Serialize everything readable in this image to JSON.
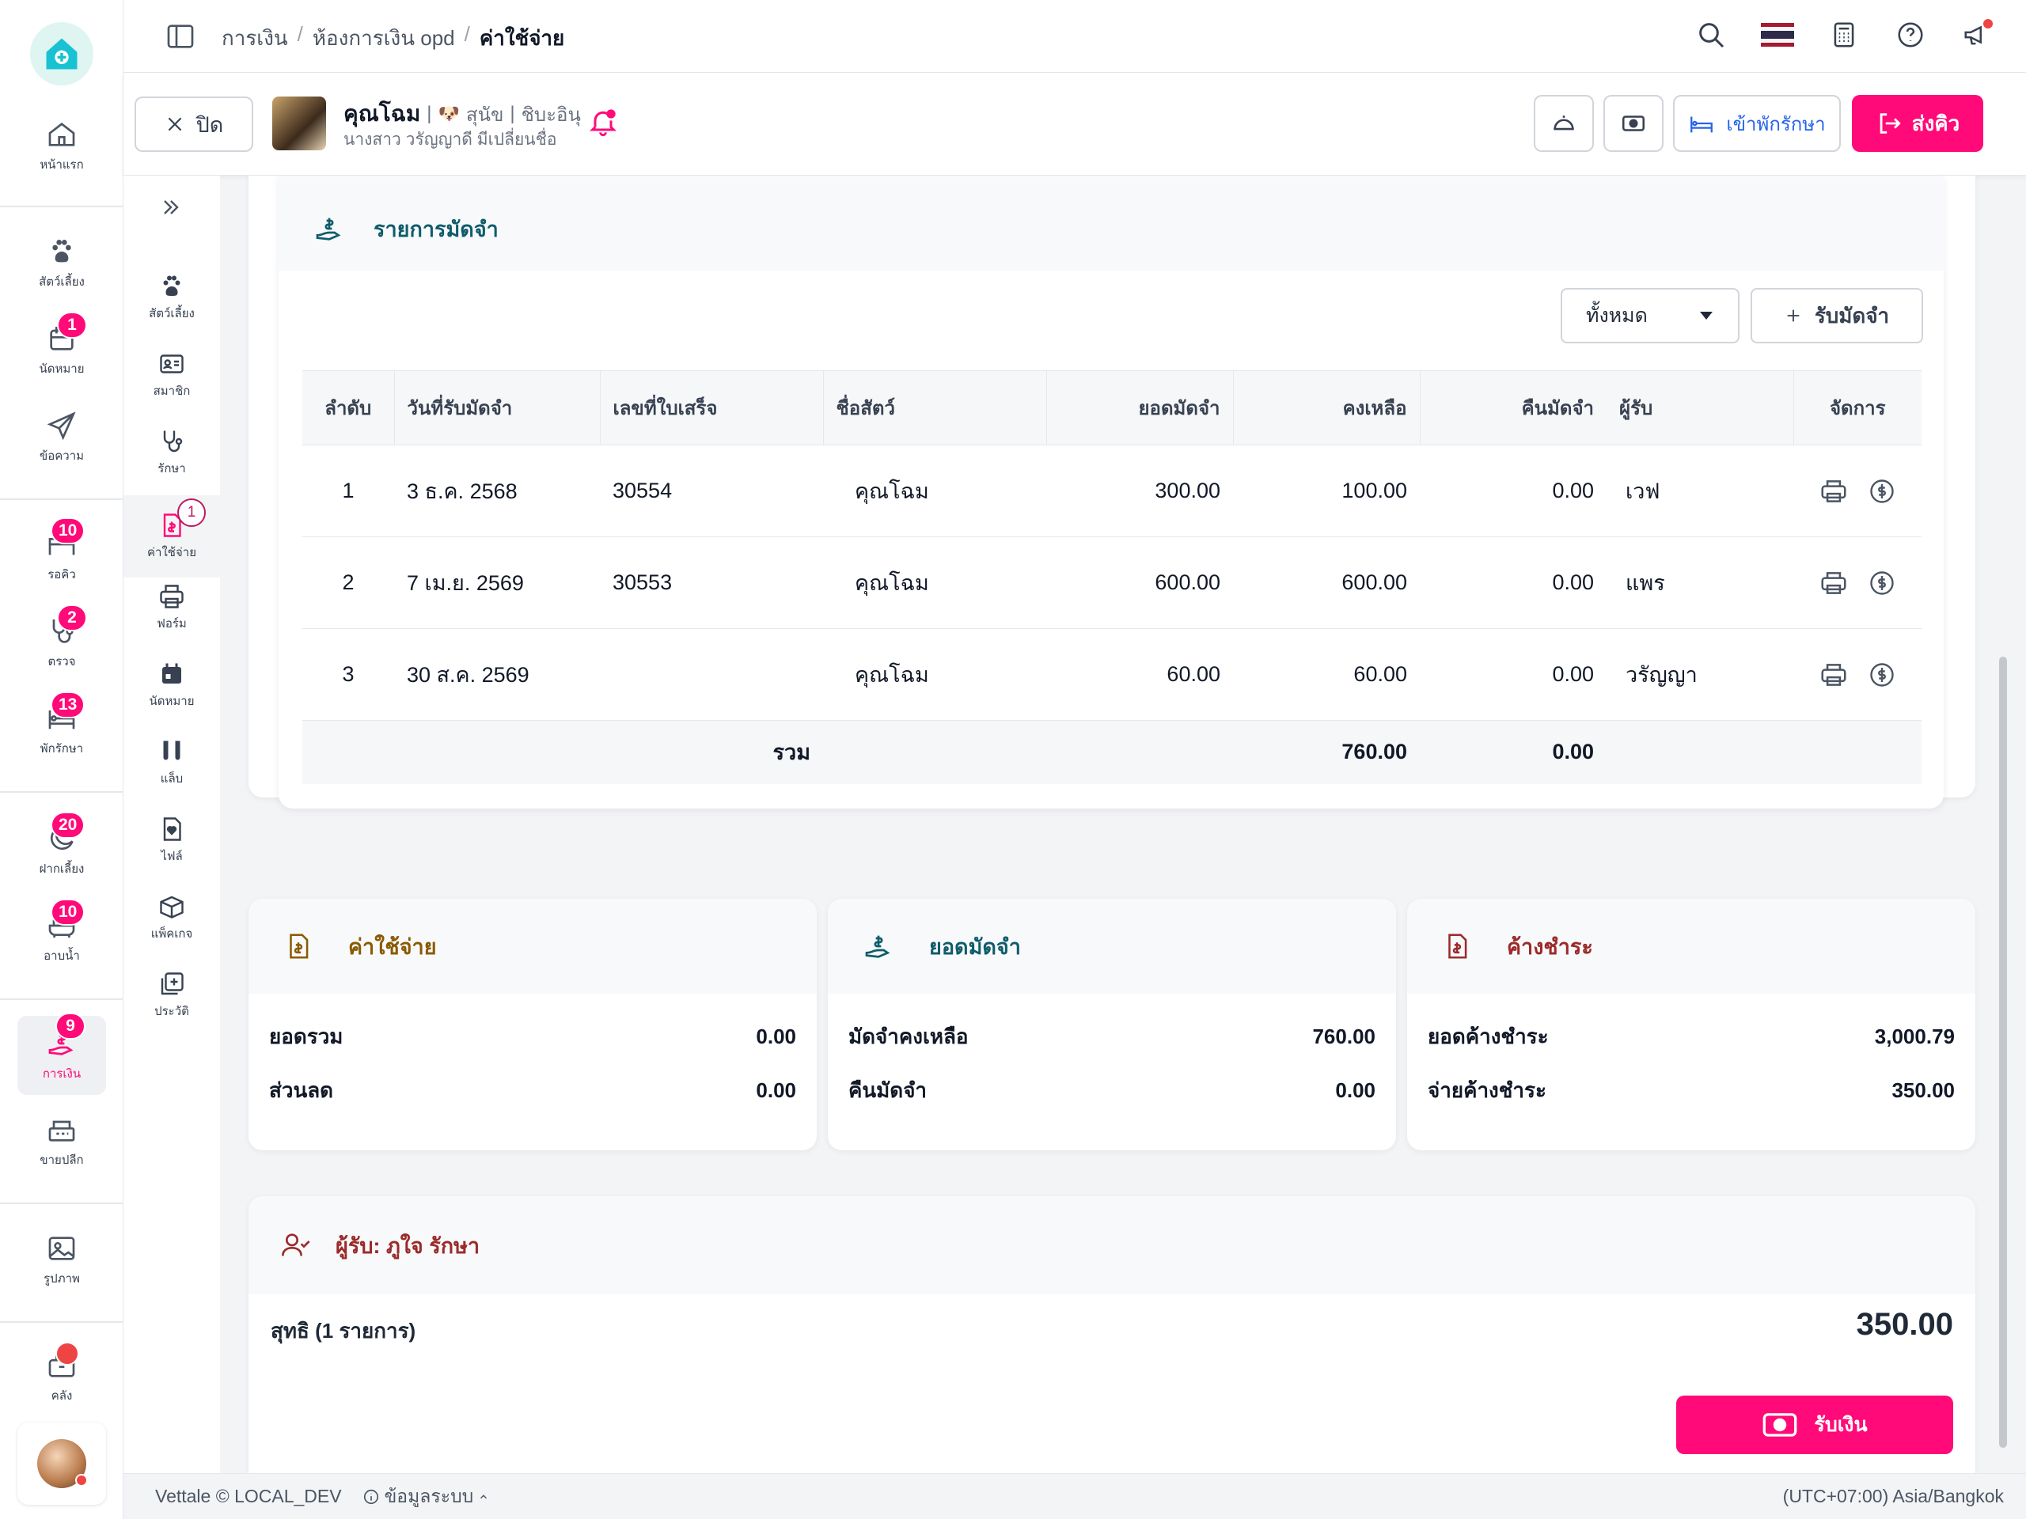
{
  "nav": {
    "items": [
      {
        "label": "หน้าแรก",
        "icon": "home-icon"
      },
      {
        "label": "สัตว์เลี้ยง",
        "icon": "paw-icon"
      },
      {
        "label": "นัดหมาย",
        "icon": "calendar-icon",
        "badge": "1"
      },
      {
        "label": "ข้อความ",
        "icon": "send-icon"
      },
      {
        "label": "รอคิว",
        "icon": "bed-icon",
        "badge": "10"
      },
      {
        "label": "ตรวจ",
        "icon": "stethoscope-icon",
        "badge": "2"
      },
      {
        "label": "พักรักษา",
        "icon": "hospital-bed-icon",
        "badge": "13"
      },
      {
        "label": "ฝากเลี้ยง",
        "icon": "moon-icon",
        "badge": "20"
      },
      {
        "label": "อาบน้ำ",
        "icon": "bath-icon",
        "badge": "10"
      },
      {
        "label": "การเงิน",
        "icon": "money-hand-icon",
        "badge": "9"
      },
      {
        "label": "ขายปลีก",
        "icon": "cash-register-icon"
      },
      {
        "label": "รูปภาพ",
        "icon": "image-icon"
      },
      {
        "label": "คลัง",
        "icon": "box-icon"
      }
    ]
  },
  "breadcrumb": [
    "การเงิน",
    "ห้องการเงิน opd",
    "ค่าใช้จ่าย"
  ],
  "patient": {
    "close_label": "ปิด",
    "pet_name": "คุณโฉม",
    "species": "สุนัข",
    "breed": "ชิบะอินุ",
    "owner": "นางสาว วรัญญาดี มีเปลี่ยนชื่อ",
    "admit_label": "เข้าพักรักษา",
    "queue_label": "ส่งคิว"
  },
  "subnav": [
    {
      "label": "สัตว์เลี้ยง",
      "icon": "paw-icon"
    },
    {
      "label": "สมาชิก",
      "icon": "id-card-icon"
    },
    {
      "label": "รักษา",
      "icon": "stethoscope-icon"
    },
    {
      "label": "ค่าใช้จ่าย",
      "icon": "bill-icon",
      "badge": "1"
    },
    {
      "label": "ฟอร์ม",
      "icon": "printer-icon"
    },
    {
      "label": "นัดหมาย",
      "icon": "calendar-icon"
    },
    {
      "label": "แล็บ",
      "icon": "test-tube-icon"
    },
    {
      "label": "ไฟล์",
      "icon": "file-heart-icon"
    },
    {
      "label": "แพ็คเกจ",
      "icon": "package-icon"
    },
    {
      "label": "ประวัติ",
      "icon": "history-icon"
    }
  ],
  "deposits": {
    "title": "รายการมัดจำ",
    "filter_value": "ทั้งหมด",
    "add_label": "รับมัดจำ",
    "columns": [
      "ลำดับ",
      "วันที่รับมัดจำ",
      "เลขที่ใบเสร็จ",
      "ชื่อสัตว์",
      "ยอดมัดจำ",
      "คงเหลือ",
      "คืนมัดจำ",
      "ผู้รับ",
      "จัดการ"
    ],
    "rows": [
      {
        "no": "1",
        "date": "3 ธ.ค. 2568",
        "receipt": "30554",
        "pet": "คุณโฉม",
        "amount": "300.00",
        "balance": "100.00",
        "refund": "0.00",
        "receiver": "เวฟ"
      },
      {
        "no": "2",
        "date": "7 เม.ย. 2569",
        "receipt": "30553",
        "pet": "คุณโฉม",
        "amount": "600.00",
        "balance": "600.00",
        "refund": "0.00",
        "receiver": "แพร"
      },
      {
        "no": "3",
        "date": "30 ส.ค. 2569",
        "receipt": "",
        "pet": "คุณโฉม",
        "amount": "60.00",
        "balance": "60.00",
        "refund": "0.00",
        "receiver": "วรัญญา"
      }
    ],
    "total_label": "รวม",
    "total_balance": "760.00",
    "total_refund": "0.00"
  },
  "summary": {
    "expense": {
      "title": "ค่าใช้จ่าย",
      "rows": [
        {
          "label": "ยอดรวม",
          "value": "0.00"
        },
        {
          "label": "ส่วนลด",
          "value": "0.00"
        }
      ]
    },
    "deposit": {
      "title": "ยอดมัดจำ",
      "rows": [
        {
          "label": "มัดจำคงเหลือ",
          "value": "760.00"
        },
        {
          "label": "คืนมัดจำ",
          "value": "0.00"
        }
      ]
    },
    "outstanding": {
      "title": "ค้างชำระ",
      "rows": [
        {
          "label": "ยอดค้างชำระ",
          "value": "3,000.79"
        },
        {
          "label": "จ่ายค้างชำระ",
          "value": "350.00"
        }
      ]
    }
  },
  "receiver": {
    "title": "ผู้รับ: ภูใจ รักษา",
    "net_label": "สุทธิ (1 รายการ)",
    "net_value": "350.00",
    "receive_label": "รับเงิน"
  },
  "footer": {
    "brand": "Vettale © LOCAL_DEV",
    "sysinfo": "ข้อมูลระบบ",
    "timezone": "(UTC+07:00) Asia/Bangkok"
  },
  "colors": {
    "accent": "#ff0a78",
    "teal": "#0f5c6b",
    "brown": "#8a5a00",
    "red": "#9b2a2a"
  }
}
